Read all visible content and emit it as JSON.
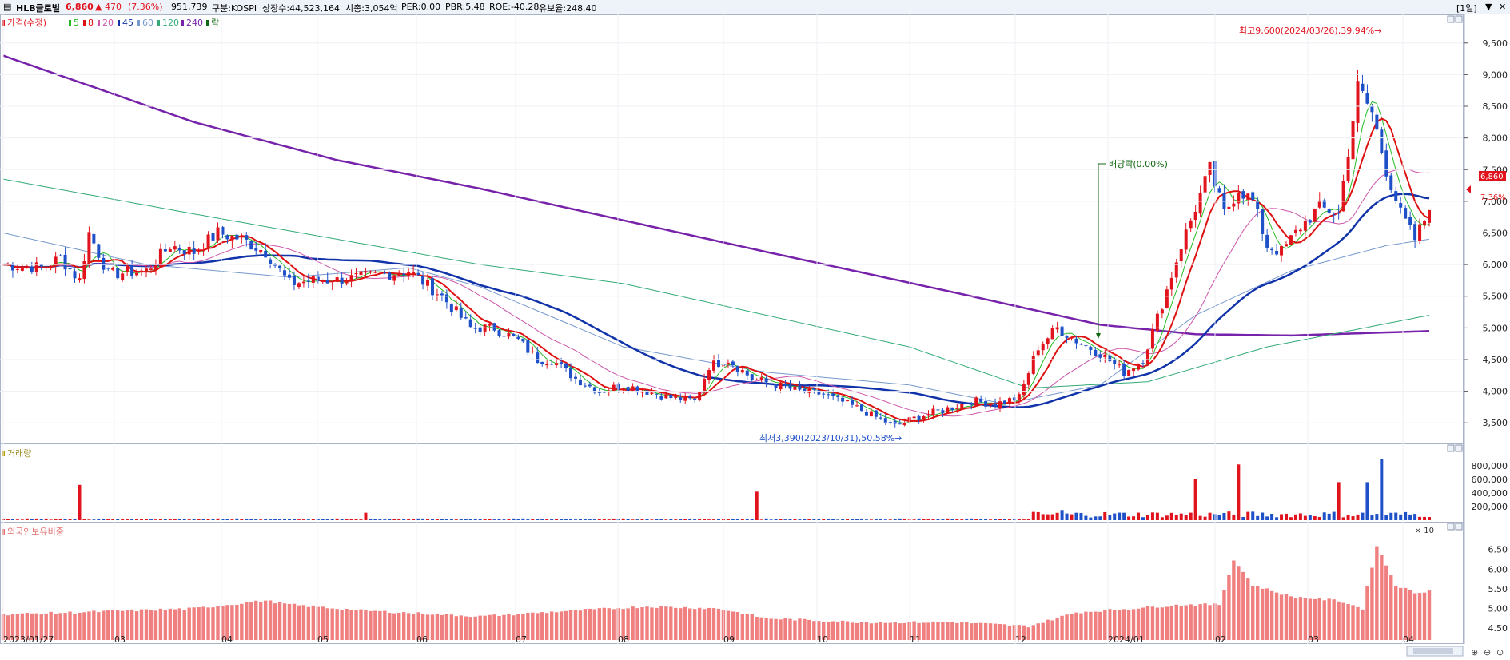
{
  "header": {
    "name": "HLB글로벌",
    "price": "6,860",
    "change": "▲ 470",
    "change_pct": "(7.36%)",
    "volume": "951,739",
    "market": "구분:KOSPI",
    "shares": "상장수:44,523,164",
    "market_cap": "시총:3,054억",
    "per": "PER:0.00",
    "pbr": "PBR:5.48",
    "roe": "ROE:-40.28",
    "float": "유보율:248.40",
    "period": "[1일]"
  },
  "legend": {
    "price": "가격(수정)",
    "ma5": "5",
    "ma8": "8",
    "ma20": "20",
    "ma45": "45",
    "ma60": "60",
    "ma120": "120",
    "ma240": "240",
    "ex": "락"
  },
  "annotations": {
    "high": "최고9,600(2024/03/26),39.94%→",
    "low": "최저3,390(2023/10/31),50.58%→",
    "dividend": "배당락(0.00%)",
    "last_price": "6,860",
    "last_pct": "7.36%"
  },
  "panels": {
    "volume_title": "거래량",
    "volume_unit": "× 10",
    "foreign_title": "외국인보유비중"
  },
  "x_labels": [
    "2023/01/27",
    "03",
    "04",
    "05",
    "06",
    "07",
    "08",
    "09",
    "10",
    "11",
    "12",
    "2024/01",
    "02",
    "03",
    "04"
  ],
  "colors": {
    "up": "#e1141e",
    "down": "#1e50c8",
    "ma5": "#22bb22",
    "ma8": "#dd1111",
    "ma20": "#cc55aa",
    "ma45": "#1133aa",
    "ma60": "#7799cc",
    "ma120": "#33aa77",
    "ma240": "#7722aa",
    "foreign_bar": "#f08080"
  },
  "chart_data": [
    {
      "type": "candlestick",
      "title": "HLB글로벌",
      "ylim": [
        3200,
        9800
      ],
      "y_ticks": [
        3500,
        4000,
        4500,
        5000,
        5500,
        6000,
        6500,
        7000,
        7500,
        8000,
        8500,
        9000,
        9500
      ],
      "y_tick_labels": [
        "3,500",
        "4,000",
        "4,500",
        "5,000",
        "5,500",
        "6,000",
        "6,500",
        "7,000",
        "7,500",
        "8,000",
        "8,500",
        "9,000",
        "9,500"
      ],
      "price_path": [
        [
          0,
          6000
        ],
        [
          8,
          5950
        ],
        [
          12,
          6100
        ],
        [
          16,
          5750
        ],
        [
          18,
          6500
        ],
        [
          22,
          5850
        ],
        [
          30,
          5900
        ],
        [
          35,
          6300
        ],
        [
          40,
          6200
        ],
        [
          45,
          6500
        ],
        [
          50,
          6400
        ],
        [
          55,
          6200
        ],
        [
          60,
          5700
        ],
        [
          65,
          5750
        ],
        [
          70,
          5750
        ],
        [
          75,
          5800
        ],
        [
          80,
          5850
        ],
        [
          85,
          5900
        ],
        [
          92,
          5500
        ],
        [
          98,
          5000
        ],
        [
          103,
          5000
        ],
        [
          108,
          4800
        ],
        [
          112,
          4500
        ],
        [
          115,
          4500
        ],
        [
          120,
          4200
        ],
        [
          125,
          4000
        ],
        [
          130,
          4100
        ],
        [
          135,
          4000
        ],
        [
          140,
          3900
        ],
        [
          145,
          3850
        ],
        [
          148,
          4400
        ],
        [
          152,
          4500
        ],
        [
          157,
          4200
        ],
        [
          162,
          4100
        ],
        [
          167,
          4000
        ],
        [
          172,
          3950
        ],
        [
          177,
          3800
        ],
        [
          180,
          3700
        ],
        [
          184,
          3550
        ],
        [
          187,
          3450
        ],
        [
          192,
          3600
        ],
        [
          197,
          3700
        ],
        [
          203,
          3850
        ],
        [
          208,
          3800
        ],
        [
          213,
          3900
        ],
        [
          217,
          4700
        ],
        [
          221,
          5000
        ],
        [
          225,
          4800
        ],
        [
          230,
          4600
        ],
        [
          235,
          4300
        ],
        [
          239,
          4500
        ],
        [
          244,
          5600
        ],
        [
          247,
          6300
        ],
        [
          250,
          6900
        ],
        [
          253,
          7500
        ],
        [
          256,
          6800
        ],
        [
          259,
          7200
        ],
        [
          262,
          7000
        ],
        [
          265,
          6300
        ],
        [
          268,
          6200
        ],
        [
          272,
          6600
        ],
        [
          276,
          6900
        ],
        [
          280,
          6800
        ],
        [
          284,
          8800
        ],
        [
          287,
          8400
        ],
        [
          290,
          7500
        ],
        [
          293,
          6800
        ],
        [
          296,
          6400
        ],
        [
          299,
          6860
        ]
      ],
      "ohlc_highlights": {
        "high": {
          "date": "2024/03/26",
          "value": 9600
        },
        "low": {
          "date": "2023/10/31",
          "value": 3390
        },
        "last": {
          "value": 6860,
          "change": 470,
          "pct": 7.36
        }
      },
      "ma240_path": [
        [
          0,
          9300
        ],
        [
          40,
          8250
        ],
        [
          70,
          7650
        ],
        [
          100,
          7200
        ],
        [
          130,
          6700
        ],
        [
          160,
          6200
        ],
        [
          200,
          5550
        ],
        [
          230,
          5050
        ],
        [
          250,
          4900
        ],
        [
          270,
          4880
        ],
        [
          299,
          4950
        ]
      ],
      "ma120_path": [
        [
          0,
          7350
        ],
        [
          40,
          6800
        ],
        [
          70,
          6400
        ],
        [
          100,
          6000
        ],
        [
          130,
          5700
        ],
        [
          160,
          5200
        ],
        [
          190,
          4700
        ],
        [
          215,
          4050
        ],
        [
          240,
          4150
        ],
        [
          265,
          4700
        ],
        [
          299,
          5200
        ]
      ],
      "ma60_path": [
        [
          0,
          6500
        ],
        [
          30,
          6000
        ],
        [
          60,
          5800
        ],
        [
          85,
          5950
        ],
        [
          100,
          5650
        ],
        [
          130,
          4700
        ],
        [
          160,
          4300
        ],
        [
          190,
          4100
        ],
        [
          210,
          3800
        ],
        [
          230,
          4100
        ],
        [
          250,
          5200
        ],
        [
          270,
          5900
        ],
        [
          290,
          6300
        ],
        [
          299,
          6400
        ]
      ]
    },
    {
      "type": "bar",
      "title": "거래량",
      "unit": "× 10",
      "y_ticks": [
        200000,
        400000,
        600000,
        800000
      ],
      "y_tick_labels": [
        "200,000",
        "400,000",
        "600,000",
        "800,000"
      ],
      "spikes": [
        [
          16,
          520000
        ],
        [
          158,
          420000
        ],
        [
          76,
          110000
        ],
        [
          222,
          150000
        ],
        [
          250,
          600000
        ],
        [
          259,
          820000
        ],
        [
          280,
          560000
        ],
        [
          289,
          900000
        ],
        [
          286,
          560000
        ]
      ]
    },
    {
      "type": "bar",
      "title": "외국인보유비중",
      "y_ticks": [
        4.5,
        5.0,
        5.5,
        6.0,
        6.5
      ],
      "y_tick_labels": [
        "4.50",
        "5.00",
        "5.50",
        "6.00",
        "6.50"
      ],
      "ylim": [
        4.2,
        6.9
      ],
      "path": [
        [
          0,
          4.85
        ],
        [
          15,
          4.9
        ],
        [
          40,
          5.0
        ],
        [
          55,
          5.2
        ],
        [
          60,
          5.1
        ],
        [
          75,
          4.95
        ],
        [
          100,
          4.8
        ],
        [
          120,
          4.95
        ],
        [
          135,
          5.05
        ],
        [
          150,
          5.0
        ],
        [
          160,
          4.75
        ],
        [
          180,
          4.65
        ],
        [
          200,
          4.65
        ],
        [
          215,
          4.55
        ],
        [
          225,
          4.9
        ],
        [
          248,
          5.1
        ],
        [
          255,
          5.1
        ],
        [
          258,
          6.25
        ],
        [
          262,
          5.6
        ],
        [
          270,
          5.3
        ],
        [
          280,
          5.2
        ],
        [
          285,
          5.0
        ],
        [
          288,
          6.6
        ],
        [
          292,
          5.6
        ],
        [
          296,
          5.4
        ],
        [
          299,
          5.45
        ]
      ]
    }
  ]
}
